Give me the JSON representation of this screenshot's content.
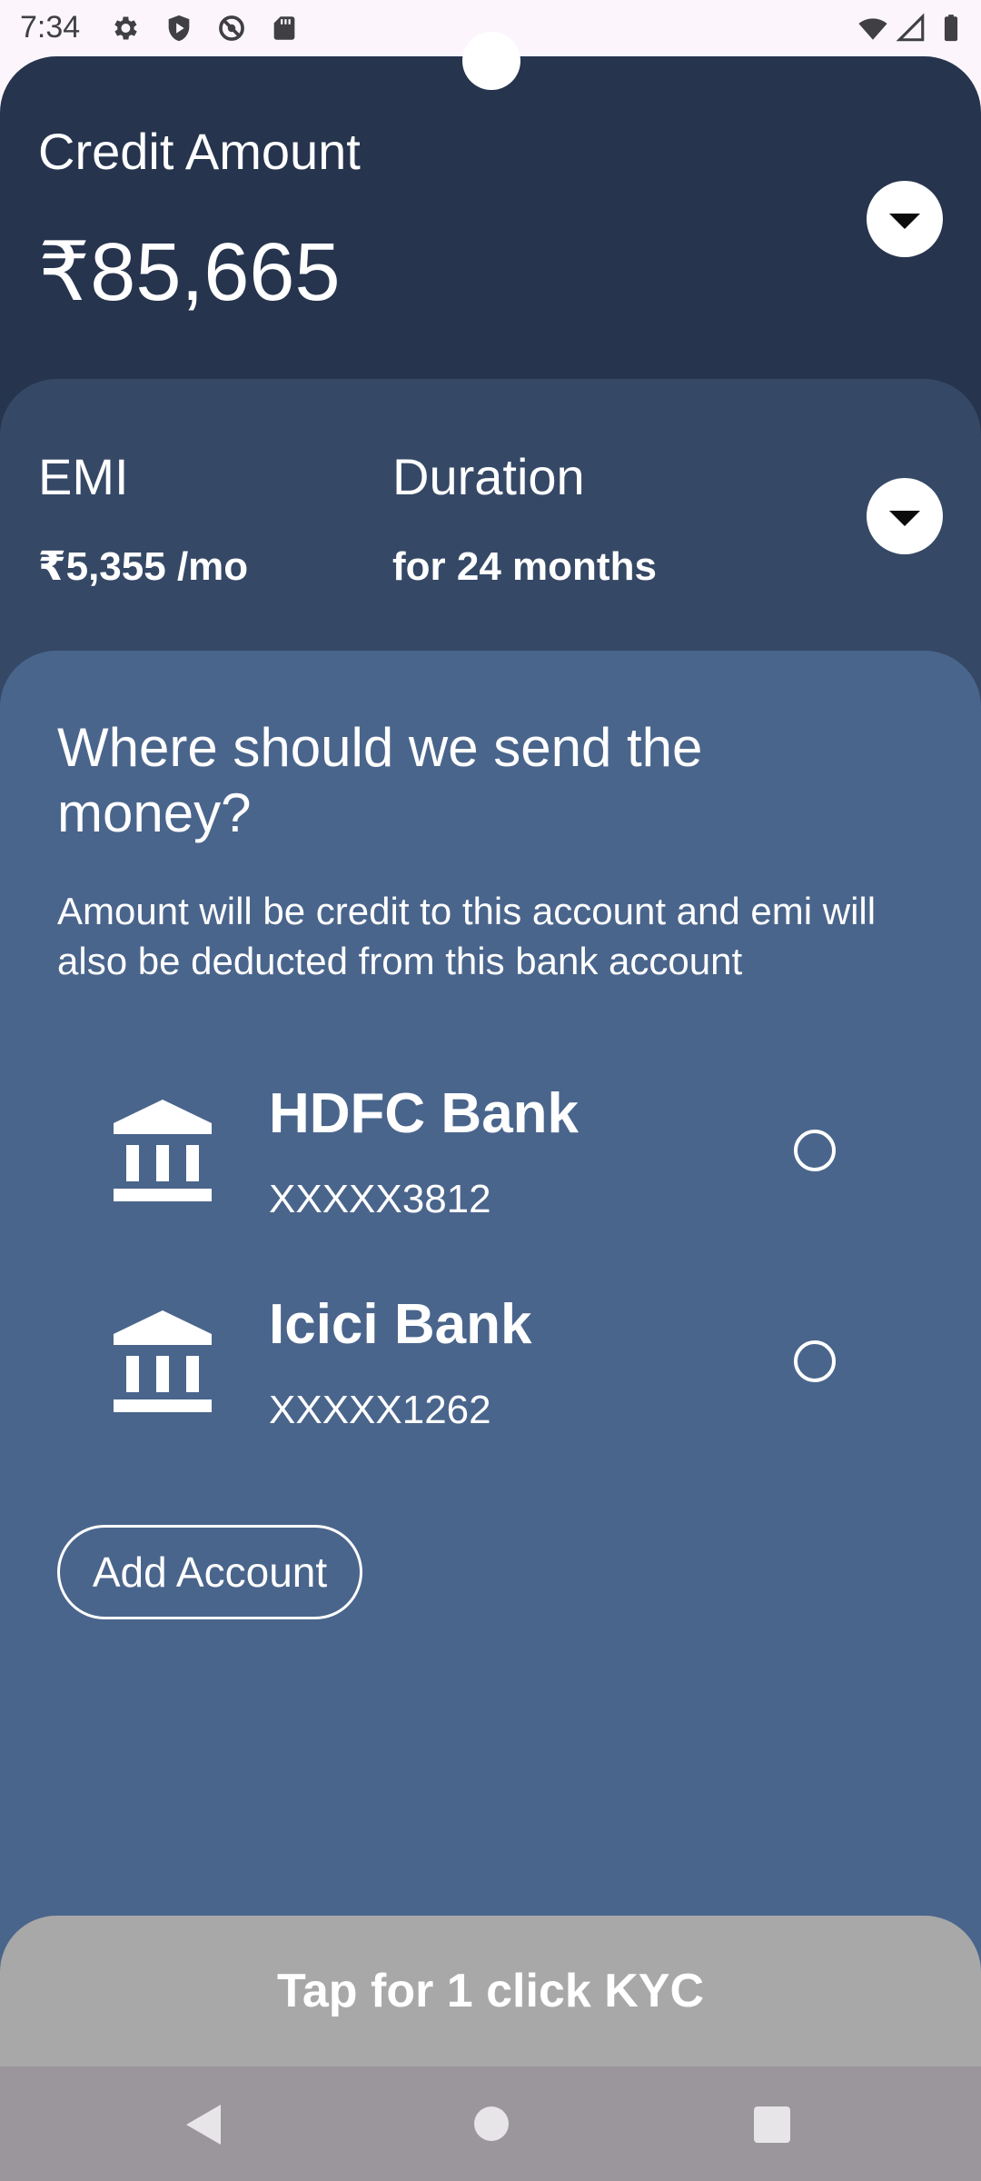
{
  "status_bar": {
    "time": "7:34",
    "left_icons": [
      "settings-icon",
      "shield-play-icon",
      "blocked-icon",
      "sd-card-icon"
    ],
    "right_icons": [
      "wifi-icon",
      "signal-icon",
      "battery-icon"
    ]
  },
  "credit": {
    "label": "Credit Amount",
    "value": "₹85,665"
  },
  "plan": {
    "emi_label": "EMI",
    "emi_value": "₹5,355 /mo",
    "duration_label": "Duration",
    "duration_value": "for 24 months"
  },
  "sheet": {
    "title": "Where should we send the money?",
    "description": "Amount will be credit to this account and emi will also be deducted from this bank account",
    "accounts": [
      {
        "name": "HDFC Bank",
        "number": "XXXXX3812",
        "selected": false,
        "icon": "bank-icon"
      },
      {
        "name": "Icici Bank",
        "number": "XXXXX1262",
        "selected": false,
        "icon": "bank-icon"
      }
    ],
    "add_account_label": "Add Account"
  },
  "kyc_button_label": "Tap for 1 click KYC",
  "colors": {
    "top_card": "#26344e",
    "middle_card": "#354866",
    "sheet": "#4a658c",
    "kyc_button": "#a8a8a8",
    "nav_bar": "#9a969b"
  }
}
